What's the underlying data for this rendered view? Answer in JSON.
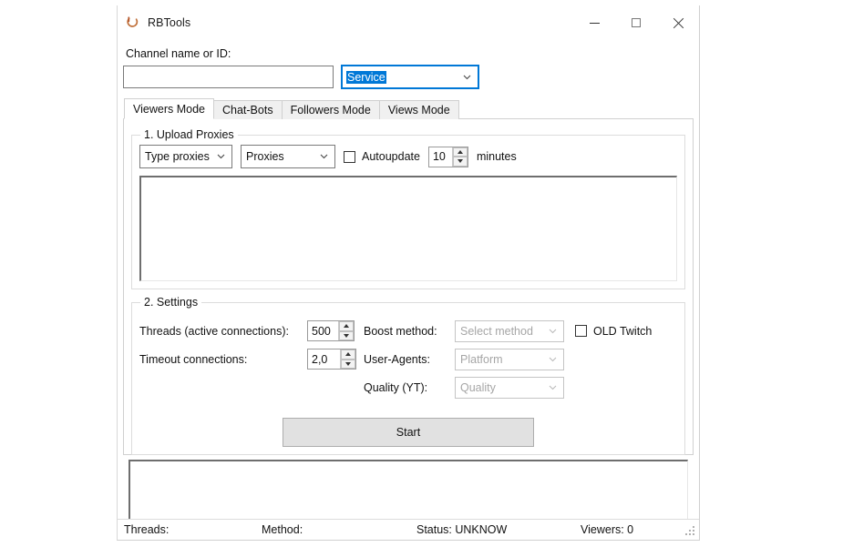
{
  "window": {
    "title": "RBTools",
    "icon": "ring-icon",
    "controls": {
      "minimize": "minimize-icon",
      "maximize": "maximize-icon",
      "close": "close-icon"
    }
  },
  "top": {
    "channel_label": "Channel name or ID:",
    "channel_value": "",
    "channel_placeholder": "",
    "service_combo": {
      "value": "Service",
      "selected": true
    }
  },
  "tabs": [
    {
      "label": "Viewers Mode",
      "active": true
    },
    {
      "label": "Chat-Bots",
      "active": false
    },
    {
      "label": "Followers Mode",
      "active": false
    },
    {
      "label": "Views Mode",
      "active": false
    }
  ],
  "upload_proxies": {
    "title": "1. Upload Proxies",
    "type_combo": "Type proxies",
    "source_combo": "Proxies",
    "autoupdate_label": "Autoupdate",
    "autoupdate_checked": false,
    "autoupdate_value": "10",
    "minutes_label": "minutes",
    "proxies_text": ""
  },
  "settings": {
    "title": "2. Settings",
    "threads_label": "Threads (active connections):",
    "threads_value": "500",
    "timeout_label": "Timeout connections:",
    "timeout_value": "2,0",
    "boost_label": "Boost method:",
    "boost_value": "Select method",
    "useragents_label": "User-Agents:",
    "useragents_value": "Platform",
    "quality_label": "Quality (YT):",
    "quality_value": "Quality",
    "old_twitch_label": "OLD Twitch",
    "old_twitch_checked": false,
    "start_label": "Start"
  },
  "log": {
    "text": ""
  },
  "statusbar": {
    "threads": "Threads:",
    "method": "Method:",
    "status": "Status: UNKNOW",
    "viewers": "Viewers: 0"
  },
  "colors": {
    "accent": "#0078d7",
    "icon": "#c0703a",
    "window_bg": "#ffffff",
    "tab_inactive": "#f0f0f0",
    "button_face": "#e1e1e1"
  }
}
